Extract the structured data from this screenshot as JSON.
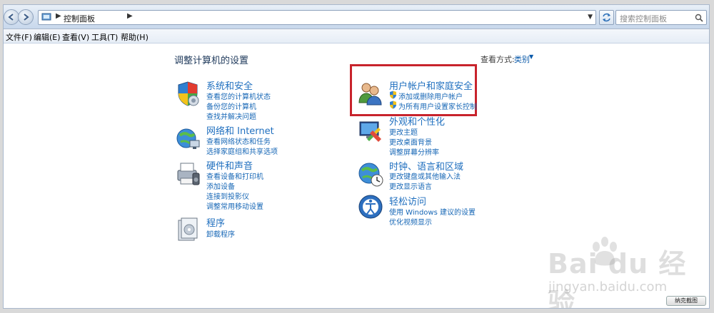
{
  "address": {
    "crumb": "控制面板",
    "search_placeholder": "搜索控制面板"
  },
  "menu": [
    "文件(F)",
    "编辑(E)",
    "查看(V)",
    "工具(T)",
    "帮助(H)"
  ],
  "main": {
    "title": "调整计算机的设置",
    "viewby_label": "查看方式:",
    "viewby_value": "类别"
  },
  "categories_left": [
    {
      "title": "系统和安全",
      "links": [
        "查看您的计算机状态",
        "备份您的计算机",
        "查找并解决问题"
      ],
      "icon": "shield-icon"
    },
    {
      "title": "网络和 Internet",
      "links": [
        "查看网络状态和任务",
        "选择家庭组和共享选项"
      ],
      "icon": "network-icon"
    },
    {
      "title": "硬件和声音",
      "links": [
        "查看设备和打印机",
        "添加设备",
        "连接到投影仪",
        "调整常用移动设置"
      ],
      "icon": "printer-icon"
    },
    {
      "title": "程序",
      "links": [
        "卸载程序"
      ],
      "icon": "programs-icon"
    }
  ],
  "categories_right": [
    {
      "title": "用户帐户和家庭安全",
      "links": [
        "添加或删除用户帐户",
        "为所有用户设置家长控制"
      ],
      "icon": "users-icon"
    },
    {
      "title": "外观和个性化",
      "links": [
        "更改主题",
        "更改桌面背景",
        "调整屏幕分辨率"
      ],
      "icon": "appearance-icon"
    },
    {
      "title": "时钟、语言和区域",
      "links": [
        "更改键盘或其他输入法",
        "更改显示语言"
      ],
      "icon": "globe-clock-icon"
    },
    {
      "title": "轻松访问",
      "links": [
        "使用 Windows 建议的设置",
        "优化视频显示"
      ],
      "icon": "accessibility-icon"
    }
  ],
  "watermark": {
    "brand": "Bai du 经验",
    "url": "jingyan.baidu.com"
  },
  "bottom_button": "纳克截图",
  "colors": {
    "link": "#1767b6",
    "highlight": "#c8232c"
  }
}
